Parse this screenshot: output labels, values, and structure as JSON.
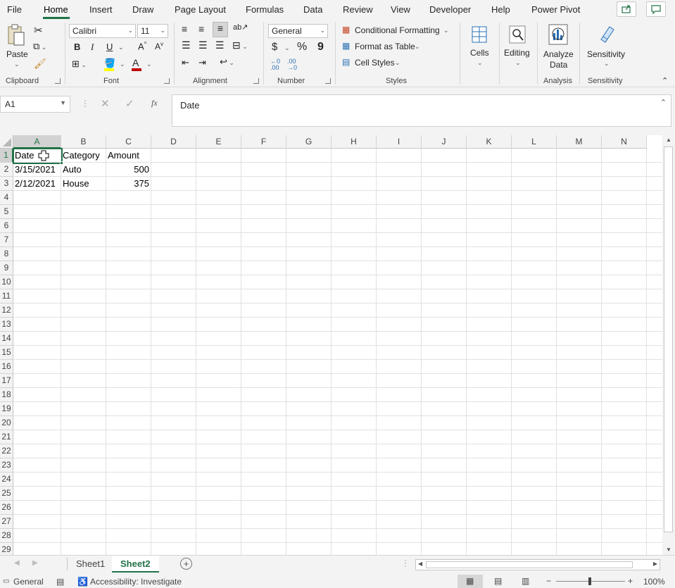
{
  "menu": {
    "tabs": [
      "File",
      "Home",
      "Insert",
      "Draw",
      "Page Layout",
      "Formulas",
      "Data",
      "Review",
      "View",
      "Developer",
      "Help",
      "Power Pivot"
    ],
    "active": "Home"
  },
  "ribbon": {
    "clipboard": {
      "paste": "Paste",
      "label": "Clipboard"
    },
    "font": {
      "name": "Calibri",
      "size": "11",
      "bold": "B",
      "italic": "I",
      "underline": "U",
      "label": "Font"
    },
    "alignment": {
      "label": "Alignment"
    },
    "number": {
      "format": "General",
      "currency": "$",
      "percent": "%",
      "comma": "9",
      "label": "Number"
    },
    "styles": {
      "conditional": "Conditional Formatting",
      "format_table": "Format as Table",
      "cell_styles": "Cell Styles",
      "label": "Styles"
    },
    "cells": {
      "label": "Cells"
    },
    "editing": {
      "label": "Editing"
    },
    "analysis": {
      "analyze": "Analyze",
      "data": "Data",
      "label": "Analysis"
    },
    "sensitivity": {
      "button": "Sensitivity",
      "label": "Sensitivity"
    }
  },
  "formula_bar": {
    "name_box": "A1",
    "content": "Date"
  },
  "columns": [
    "A",
    "B",
    "C",
    "D",
    "E",
    "F",
    "G",
    "H",
    "I",
    "J",
    "K",
    "L",
    "M",
    "N"
  ],
  "rows": [
    "1",
    "2",
    "3",
    "4",
    "5",
    "6",
    "7",
    "8",
    "9",
    "10",
    "11",
    "12",
    "13",
    "14",
    "15",
    "16",
    "17",
    "18",
    "19",
    "20",
    "21",
    "22",
    "23",
    "24",
    "25",
    "26",
    "27",
    "28",
    "29"
  ],
  "cells": {
    "A1": "Date",
    "B1": "Category",
    "C1": "Amount",
    "A2": "3/15/2021",
    "B2": "Auto",
    "C2": "500",
    "A3": "2/12/2021",
    "B3": "House",
    "C3": "375"
  },
  "sheets": {
    "tab1": "Sheet1",
    "tab2": "Sheet2"
  },
  "status": {
    "mode": "General",
    "accessibility": "Accessibility: Investigate",
    "zoom": "100%"
  },
  "colors": {
    "accent": "#217346",
    "font_color_bar": "#c00000",
    "highlight_bar": "#ffff00"
  }
}
